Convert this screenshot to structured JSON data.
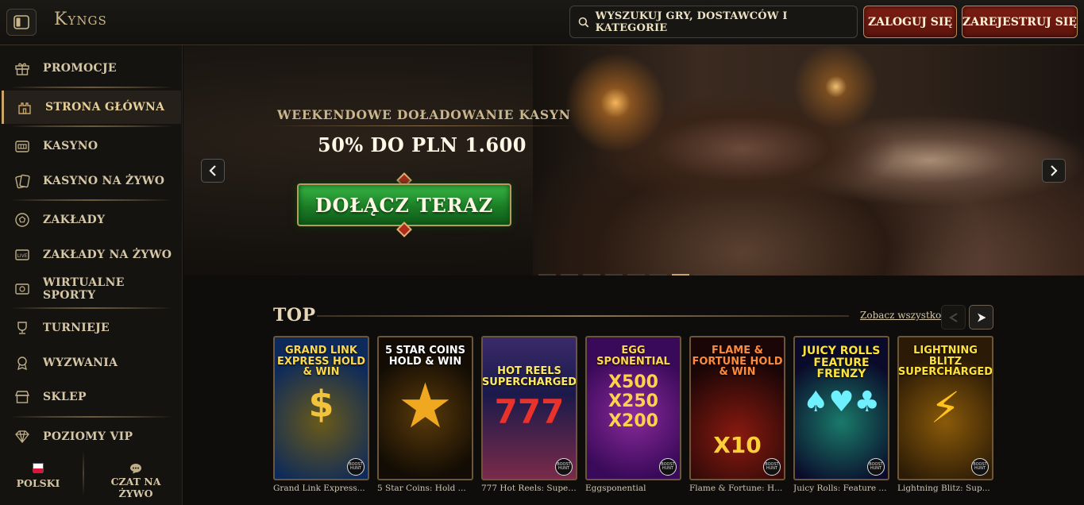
{
  "header": {
    "logo": "Kyngs",
    "search_placeholder": "WYSZUKUJ GRY, DOSTAWCÓW I KATEGORIE",
    "login_label": "ZALOGUJ SIĘ",
    "register_label": "ZAREJESTRUJ SIĘ"
  },
  "sidebar": {
    "items": [
      {
        "label": "PROMOCJE",
        "icon": "gift-icon"
      },
      {
        "label": "STRONA GŁÓWNA",
        "icon": "castle-icon",
        "active": true
      },
      {
        "label": "KASYNO",
        "icon": "slot-machine-icon"
      },
      {
        "label": "KASYNO NA ŻYWO",
        "icon": "cards-icon"
      },
      {
        "label": "ZAKŁADY",
        "icon": "soccer-ball-icon"
      },
      {
        "label": "ZAKŁADY NA ŻYWO",
        "icon": "live-icon"
      },
      {
        "label": "WIRTUALNE SPORTY",
        "icon": "virtual-sports-icon"
      },
      {
        "label": "TURNIEJE",
        "icon": "trophy-icon"
      },
      {
        "label": "WYZWANIA",
        "icon": "medal-icon"
      },
      {
        "label": "SKLEP",
        "icon": "shop-icon"
      },
      {
        "label": "POZIOMY VIP",
        "icon": "diamond-icon"
      }
    ],
    "language_label": "POLSKI",
    "chat_label": "CZAT NA ŻYWO"
  },
  "banner": {
    "subtitle": "WEEKENDOWE DOŁADOWANIE KASYN",
    "headline": "50% DO PLN 1.600",
    "cta_label": "DOŁĄCZ TERAZ",
    "slide_count": 9,
    "active_slide": 6
  },
  "top_section": {
    "title": "TOP",
    "see_all_label": "Zobacz wszystko",
    "games": [
      {
        "caption": "Grand Link Express...",
        "art_title": "GRAND LINK EXPRESS HOLD & WIN",
        "art_glyph": "$"
      },
      {
        "caption": "5 Star Coins: Hold ...",
        "art_title": "5 STAR COINS HOLD & WIN",
        "art_glyph": "★"
      },
      {
        "caption": "777 Hot Reels: Super...",
        "art_title": "HOT REELS SUPERCHARGED",
        "art_glyph": "777"
      },
      {
        "caption": "Eggsponential",
        "art_title": "EGG SPONENTIAL",
        "art_glyph": "X500 X250 X200"
      },
      {
        "caption": "Flame & Fortune: H...",
        "art_title": "FLAME & FORTUNE HOLD & WIN",
        "art_glyph": "X10"
      },
      {
        "caption": "Juicy Rolls: Feature ...",
        "art_title": "JUICY ROLLS FEATURE FRENZY",
        "art_glyph": "♠♥♣"
      },
      {
        "caption": "Lightning Blitz: Sup...",
        "art_title": "LIGHTNING BLITZ SUPERCHARGED",
        "art_glyph": "⚡"
      }
    ]
  },
  "colors": {
    "accent_gold": "#c9a567",
    "button_red": "#7d1e14",
    "cta_green": "#2a9a36",
    "background": "#0d0c0b"
  }
}
